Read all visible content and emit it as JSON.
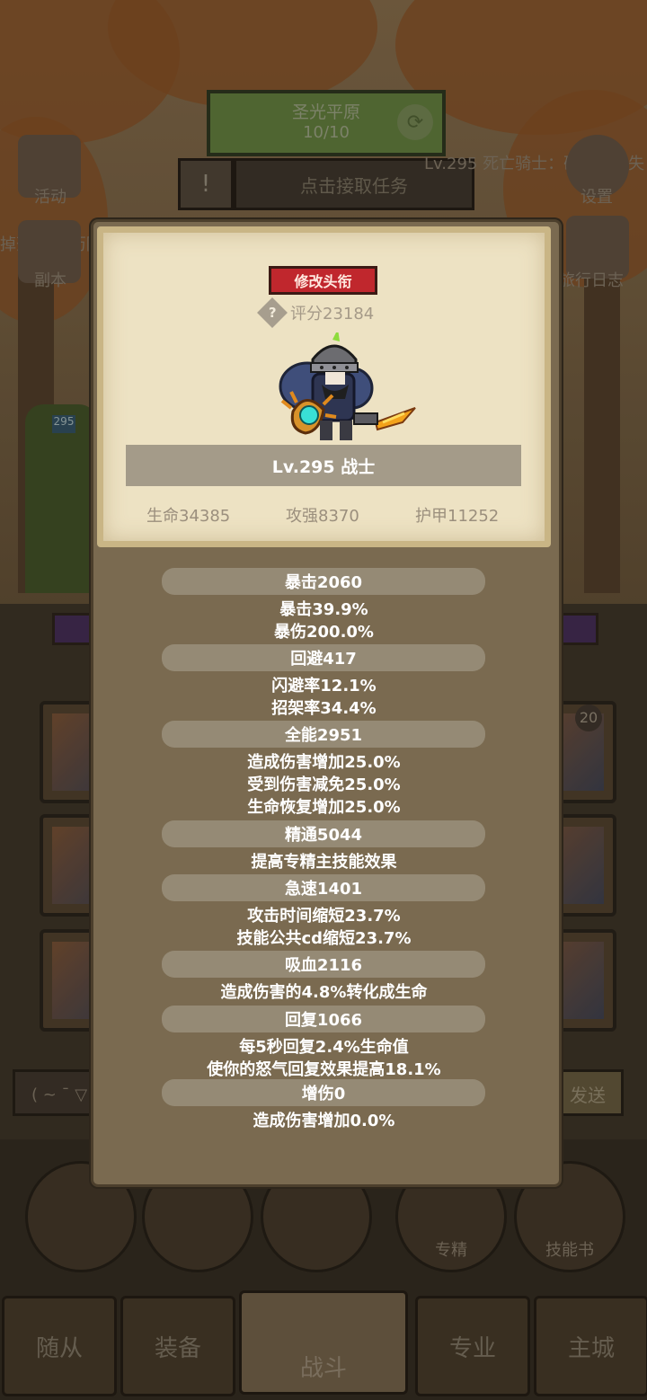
{
  "background": {
    "zone": {
      "name": "圣光平原",
      "progress": "10/10"
    },
    "quest_button": "点击接取任务",
    "boss_text": "Lv.295 死亡骑士：硬币不消失",
    "left_icons": [
      {
        "label": "活动"
      },
      {
        "label": "副本"
      }
    ],
    "right_icons": [
      {
        "label": "设置"
      },
      {
        "label": "旅行日志"
      }
    ],
    "side_text": "掉落产出 历防",
    "level_badge": "295",
    "chat_hint": "( ~ ¯ ▽",
    "send_label": "发送",
    "slot_badge": "20",
    "menu_buttons": [
      {
        "label": ""
      },
      {
        "label": ""
      },
      {
        "label": ""
      },
      {
        "label": "专精"
      },
      {
        "label": "技能书"
      }
    ],
    "nav_tabs": [
      "随从",
      "装备",
      "战斗",
      "专业",
      "主城"
    ]
  },
  "popup": {
    "change_title_button": "修改头衔",
    "score": "评分23184",
    "hero_name": "Lv.295 战士",
    "base_stats": {
      "hp": "生命34385",
      "attack": "攻强8370",
      "armor": "护甲11252"
    },
    "attributes": [
      {
        "head": "暴击2060",
        "lines": [
          "暴击39.9%",
          "暴伤200.0%"
        ]
      },
      {
        "head": "回避417",
        "lines": [
          "闪避率12.1%",
          "招架率34.4%"
        ]
      },
      {
        "head": "全能2951",
        "lines": [
          "造成伤害增加25.0%",
          "受到伤害减免25.0%",
          "生命恢复增加25.0%"
        ]
      },
      {
        "head": "精通5044",
        "lines": [
          "提高专精主技能效果"
        ]
      },
      {
        "head": "急速1401",
        "lines": [
          "攻击时间缩短23.7%",
          "技能公共cd缩短23.7%"
        ]
      },
      {
        "head": "吸血2116",
        "lines": [
          "造成伤害的4.8%转化成生命"
        ]
      },
      {
        "head": "回复1066",
        "lines": [
          "每5秒回复2.4%生命值",
          "使你的怒气回复效果提高18.1%"
        ]
      },
      {
        "head": "增伤0",
        "lines": [
          "造成伤害增加0.0%"
        ]
      }
    ]
  },
  "colors": {
    "title_button": "#c0272d",
    "panel": "#7a6a50",
    "card": "#ede2c3",
    "stat_bar": "#958a75"
  }
}
